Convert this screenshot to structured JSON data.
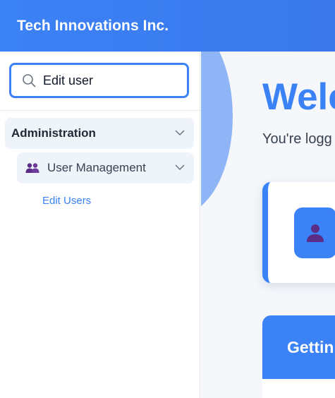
{
  "header": {
    "title": "Tech Innovations Inc."
  },
  "search": {
    "value": "Edit user"
  },
  "sidebar": {
    "group": {
      "label": "Administration",
      "icon": "chevron-down-icon"
    },
    "subgroup": {
      "label": "User Management",
      "icon": "users-icon"
    },
    "leaf": {
      "label": "Edit Users"
    }
  },
  "main": {
    "welcome_title": "Welc",
    "welcome_subtitle": "You're logg",
    "card_icon": "user-icon",
    "panel_title": "Gettin"
  },
  "colors": {
    "accent": "#3b82f6",
    "nav_bg": "#eff4fb",
    "icon_purple": "#5b2d86"
  }
}
